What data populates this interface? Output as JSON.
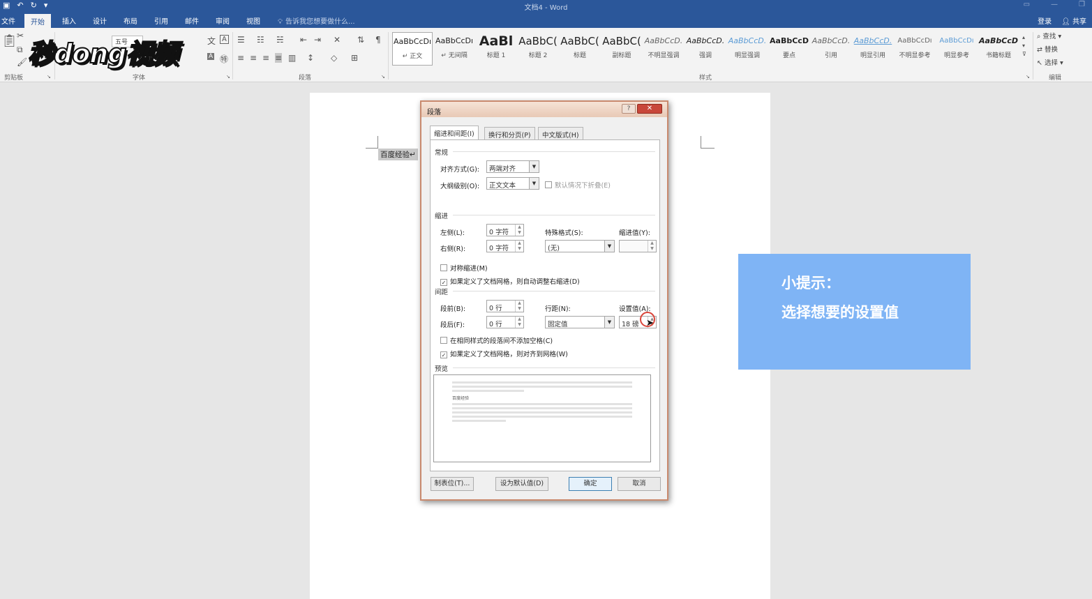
{
  "window": {
    "title": "文档4 - Word"
  },
  "tabs": [
    "文件",
    "开始",
    "插入",
    "设计",
    "布局",
    "引用",
    "邮件",
    "审阅",
    "视图"
  ],
  "active_tab": "开始",
  "tell_me": "告诉我您想要做什么...",
  "account": {
    "login": "登录",
    "share": "共享"
  },
  "ribbon": {
    "groups": {
      "clipboard": "剪贴板",
      "font": "字体",
      "paragraph": "段落",
      "styles": "样式",
      "editing": "编辑"
    },
    "font_size": "五号",
    "styles": [
      {
        "preview": "AaBbCcDı",
        "name": "↵ 正文"
      },
      {
        "preview": "AaBbCcDı",
        "name": "↵ 无间隔"
      },
      {
        "preview": "AaBl",
        "name": "标题 1"
      },
      {
        "preview": "AaBbC(",
        "name": "标题 2"
      },
      {
        "preview": "AaBbC(",
        "name": "标题"
      },
      {
        "preview": "AaBbC(",
        "name": "副标题"
      },
      {
        "preview": "AaBbCcD.",
        "name": "不明显强调"
      },
      {
        "preview": "AaBbCcD.",
        "name": "强调"
      },
      {
        "preview": "AaBbCcD.",
        "name": "明显强调"
      },
      {
        "preview": "AaBbCcD",
        "name": "要点"
      },
      {
        "preview": "AaBbCcD.",
        "name": "引用"
      },
      {
        "preview": "AaBbCcD.",
        "name": "明显引用"
      },
      {
        "preview": "AaBbCcDı",
        "name": "不明显参考"
      },
      {
        "preview": "AaBbCcDı",
        "name": "明显参考"
      },
      {
        "preview": "AaBbCcD",
        "name": "书籍标题"
      }
    ],
    "editing": {
      "find": "查找",
      "replace": "替换",
      "select": "选择"
    }
  },
  "watermark_logo": "秒dong视频",
  "document": {
    "text": "百度经验↵"
  },
  "dialog": {
    "title": "段落",
    "help": "?",
    "close": "✕",
    "tabs": [
      "缩进和间距(I)",
      "换行和分页(P)",
      "中文版式(H)"
    ],
    "general": {
      "section": "常规",
      "alignment_label": "对齐方式(G):",
      "alignment_value": "两端对齐",
      "outline_label": "大纲级别(O):",
      "outline_value": "正文文本",
      "collapsed_label": "默认情况下折叠(E)"
    },
    "indent": {
      "section": "缩进",
      "left_label": "左侧(L):",
      "left_value": "0 字符",
      "right_label": "右侧(R):",
      "right_value": "0 字符",
      "special_label": "特殊格式(S):",
      "special_value": "(无)",
      "by_label": "缩进值(Y):",
      "by_value": "",
      "mirror_label": "对称缩进(M)",
      "auto_adjust_label": "如果定义了文档网格，则自动调整右缩进(D)"
    },
    "spacing": {
      "section": "间距",
      "before_label": "段前(B):",
      "before_value": "0 行",
      "after_label": "段后(F):",
      "after_value": "0 行",
      "line_label": "行距(N):",
      "line_value": "固定值",
      "at_label": "设置值(A):",
      "at_value": "18 磅",
      "no_space_label": "在相同样式的段落间不添加空格(C)",
      "snap_label": "如果定义了文档网格，则对齐到网格(W)"
    },
    "preview": {
      "section": "预览",
      "sample": "百度经验"
    },
    "buttons": {
      "tabs": "制表位(T)...",
      "default": "设为默认值(D)",
      "ok": "确定",
      "cancel": "取消"
    }
  },
  "tip": {
    "title": "小提示：",
    "text": "选择想要的设置值"
  }
}
